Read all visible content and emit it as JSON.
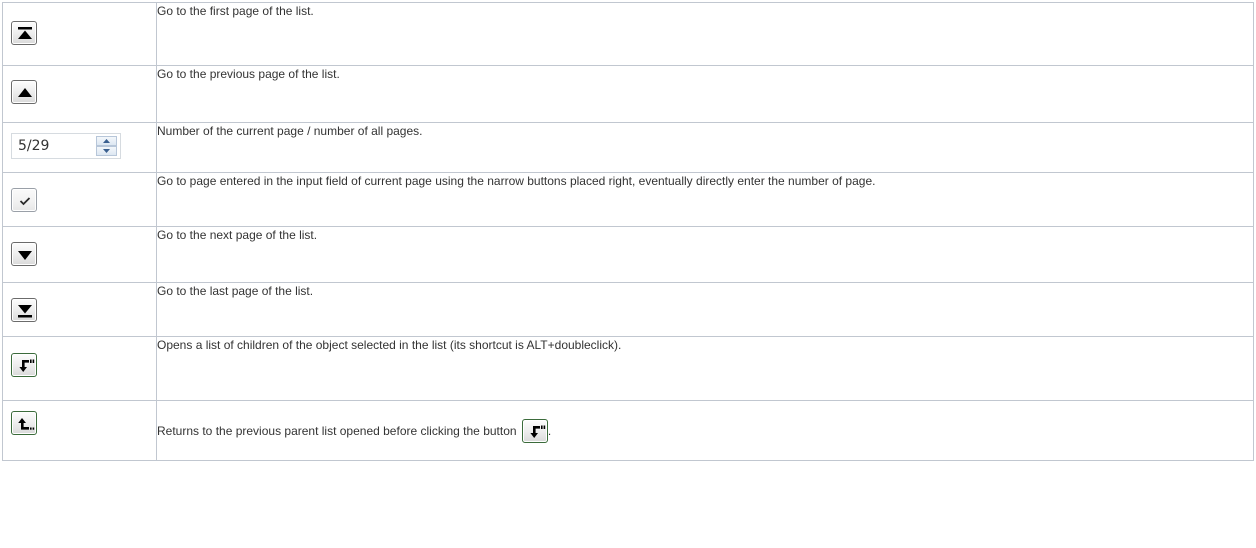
{
  "rows": [
    {
      "icon": "first-page-icon",
      "text": "Go to the first page of the list."
    },
    {
      "icon": "previous-page-icon",
      "text": "Go to the previous page of the list."
    },
    {
      "icon": "page-spinner",
      "text": "Number of the current page / number of all pages."
    },
    {
      "icon": "checkmark-icon",
      "text": "Go to page entered in the input field of current page using the narrow buttons placed right, eventually directly enter the number of page."
    },
    {
      "icon": "next-page-icon",
      "text": "Go to the next page of the list."
    },
    {
      "icon": "last-page-icon",
      "text": "Go to the last page of the list."
    },
    {
      "icon": "open-children-icon",
      "text": "Opens a list of children of the object selected in the list (its shortcut is ALT+doubleclick)."
    },
    {
      "icon": "return-parent-icon",
      "text_before": "Returns to the previous parent list opened before clicking the button",
      "text_after": "."
    }
  ],
  "spinner": {
    "value": "5/29"
  },
  "colors": {
    "border": "#c1c7d0",
    "text": "#333333",
    "icon": "#000000"
  }
}
